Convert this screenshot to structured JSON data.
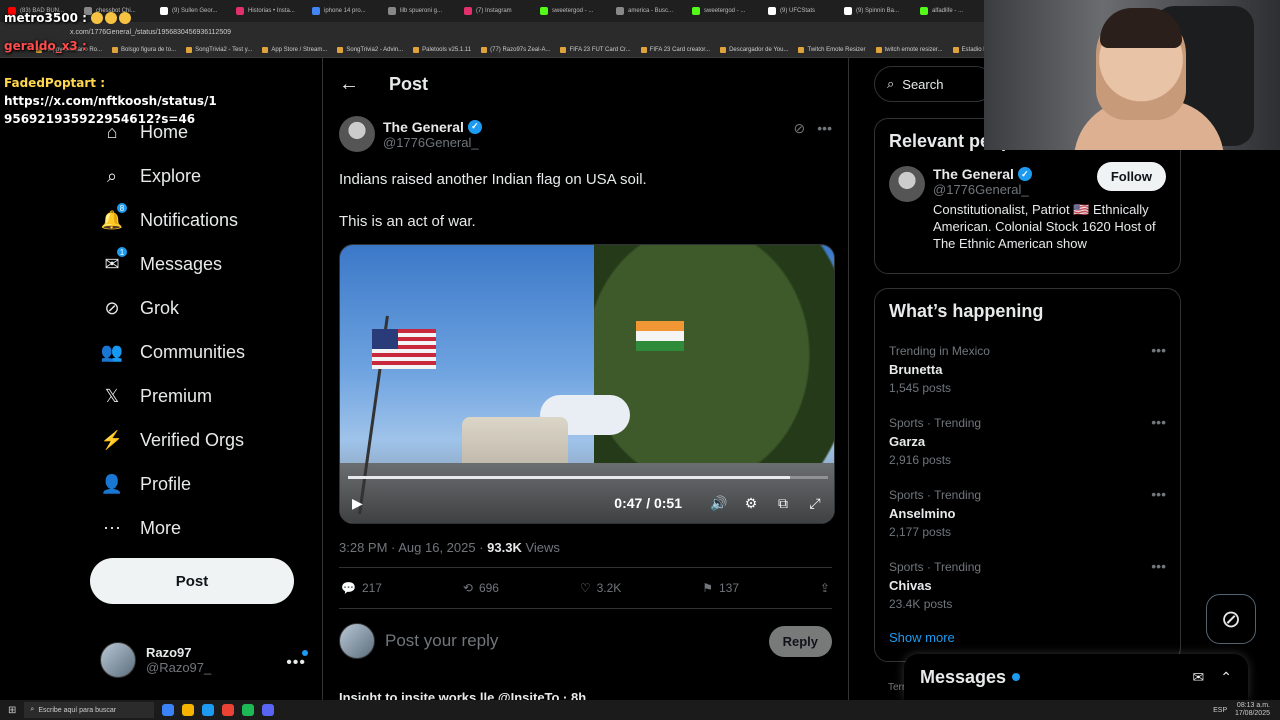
{
  "browser": {
    "tabs": [
      {
        "label": "(83) BAD BUN...",
        "color": "#ff0000"
      },
      {
        "label": "chessbot Chi...",
        "color": "#888888"
      },
      {
        "label": "(9) Sullen Geor...",
        "color": "#ffffff"
      },
      {
        "label": "Historias • Insta...",
        "color": "#e1306c"
      },
      {
        "label": "iphone 14 pro...",
        "color": "#4285f4"
      },
      {
        "label": "lilb spueroni g...",
        "color": "#888888"
      },
      {
        "label": "(7) Instagram",
        "color": "#e1306c"
      },
      {
        "label": "sweetergod - ...",
        "color": "#53fc18"
      },
      {
        "label": "america - Busc...",
        "color": "#888888"
      },
      {
        "label": "sweetergod - ...",
        "color": "#53fc18"
      },
      {
        "label": "(9) UFCStats",
        "color": "#ffffff"
      },
      {
        "label": "(9) Spinnin Ba...",
        "color": "#ffffff"
      },
      {
        "label": "alfadlife - ...",
        "color": "#53fc18"
      }
    ],
    "address": "x.com/1776General_/status/1956830456936112509",
    "bookmarks": [
      "Happy Cristiano Ro...",
      "Bolsgo figura de to...",
      "SongTrivia2 - Test y...",
      "App Store / Stream...",
      "SongTrivia2 - Advin...",
      "Paletools v25.1.11",
      "(77) Razo97s Zeal-A...",
      "FIFA 23 FUT Card Cr...",
      "FIFA 23 Card creator...",
      "Descargador de You...",
      "Twitch Emote Resizer",
      "twitch emote resizer...",
      "Estadio Pres"
    ]
  },
  "chat": {
    "line1_user": "metro3500 :",
    "line2_user": "geraldo_x3 :",
    "line3_user": "FadedPoptart :",
    "line3_link": "https://x.com/nftkoosh/status/1956921935922954612?s=46"
  },
  "sidebar": {
    "items": [
      {
        "label": "Home",
        "icon": "home-icon",
        "badge": ""
      },
      {
        "label": "Explore",
        "icon": "search-icon",
        "badge": ""
      },
      {
        "label": "Notifications",
        "icon": "bell-icon",
        "badge": "8"
      },
      {
        "label": "Messages",
        "icon": "mail-icon",
        "badge": "1"
      },
      {
        "label": "Grok",
        "icon": "grok-icon",
        "badge": ""
      },
      {
        "label": "Communities",
        "icon": "people-icon",
        "badge": ""
      },
      {
        "label": "Premium",
        "icon": "x-logo-icon",
        "badge": ""
      },
      {
        "label": "Verified Orgs",
        "icon": "lightning-icon",
        "badge": ""
      },
      {
        "label": "Profile",
        "icon": "person-icon",
        "badge": ""
      },
      {
        "label": "More",
        "icon": "more-circle-icon",
        "badge": ""
      }
    ],
    "post_button": "Post",
    "account": {
      "name": "Razo97",
      "handle": "@Razo97_"
    }
  },
  "main": {
    "header_title": "Post",
    "tweet": {
      "author_name": "The General",
      "author_handle": "@1776General_",
      "text_line1": "Indians raised another Indian flag on USA soil.",
      "text_line2": "This is an act of war.",
      "video_time": "0:47 / 0:51",
      "video_progress": 0.92,
      "timestamp": "3:28 PM · Aug 16, 2025 · ",
      "views_count": "93.3K",
      "views_label": " Views",
      "replies": "217",
      "reposts": "696",
      "likes": "3.2K",
      "bookmarks": "137"
    },
    "reply_placeholder": "Post your reply",
    "reply_button": "Reply",
    "next_tweet_preview": "Insight to insite works lle   @InsiteTo · 8h"
  },
  "right": {
    "search_placeholder": "Search",
    "relevant_title": "Relevant people",
    "relevant_person": {
      "name": "The General",
      "handle": "@1776General_",
      "bio": "Constitutionalist, Patriot 🇺🇸 Ethnically American. Colonial Stock 1620 Host of The Ethnic American show",
      "follow": "Follow"
    },
    "happening_title": "What’s happening",
    "trends": [
      {
        "context": "Trending in Mexico",
        "title": "Brunetta",
        "count": "1,545 posts"
      },
      {
        "context": "Sports · Trending",
        "title": "Garza",
        "count": "2,916 posts"
      },
      {
        "context": "Sports · Trending",
        "title": "Anselmino",
        "count": "2,177 posts"
      },
      {
        "context": "Sports · Trending",
        "title": "Chivas",
        "count": "23.4K posts"
      }
    ],
    "show_more": "Show more",
    "messages_title": "Messages",
    "terms_text": "Terr"
  },
  "taskbar": {
    "search_placeholder": "Escribe aquí para buscar",
    "time": "08:13 a.m.",
    "date": "17/08/2025",
    "lang": "ESP"
  },
  "colors": {
    "accent": "#1d9bf0",
    "background": "#000000",
    "border": "#2f3336",
    "muted": "#71767b"
  }
}
